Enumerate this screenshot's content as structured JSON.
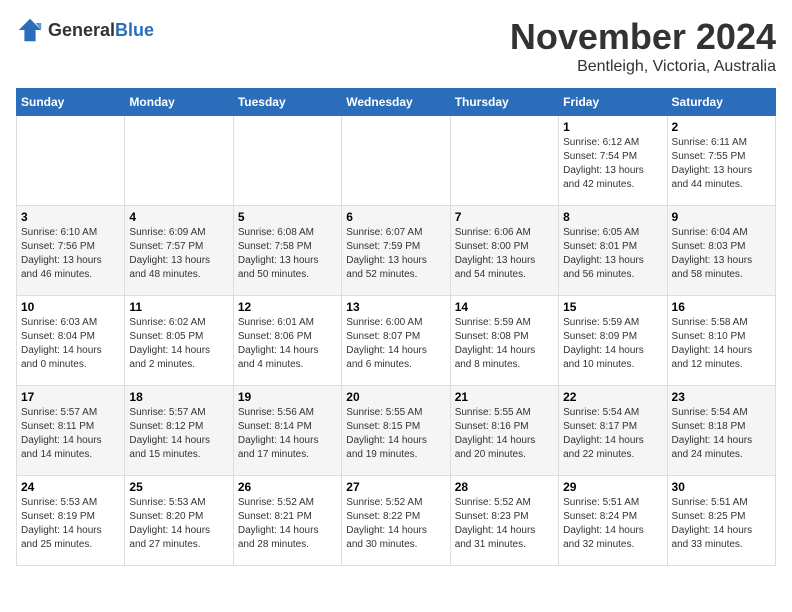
{
  "header": {
    "logo_general": "General",
    "logo_blue": "Blue",
    "month_year": "November 2024",
    "location": "Bentleigh, Victoria, Australia"
  },
  "days_of_week": [
    "Sunday",
    "Monday",
    "Tuesday",
    "Wednesday",
    "Thursday",
    "Friday",
    "Saturday"
  ],
  "weeks": [
    {
      "id": "week1",
      "days": [
        {
          "date": "",
          "info": ""
        },
        {
          "date": "",
          "info": ""
        },
        {
          "date": "",
          "info": ""
        },
        {
          "date": "",
          "info": ""
        },
        {
          "date": "",
          "info": ""
        },
        {
          "date": "1",
          "info": "Sunrise: 6:12 AM\nSunset: 7:54 PM\nDaylight: 13 hours\nand 42 minutes."
        },
        {
          "date": "2",
          "info": "Sunrise: 6:11 AM\nSunset: 7:55 PM\nDaylight: 13 hours\nand 44 minutes."
        }
      ]
    },
    {
      "id": "week2",
      "days": [
        {
          "date": "3",
          "info": "Sunrise: 6:10 AM\nSunset: 7:56 PM\nDaylight: 13 hours\nand 46 minutes."
        },
        {
          "date": "4",
          "info": "Sunrise: 6:09 AM\nSunset: 7:57 PM\nDaylight: 13 hours\nand 48 minutes."
        },
        {
          "date": "5",
          "info": "Sunrise: 6:08 AM\nSunset: 7:58 PM\nDaylight: 13 hours\nand 50 minutes."
        },
        {
          "date": "6",
          "info": "Sunrise: 6:07 AM\nSunset: 7:59 PM\nDaylight: 13 hours\nand 52 minutes."
        },
        {
          "date": "7",
          "info": "Sunrise: 6:06 AM\nSunset: 8:00 PM\nDaylight: 13 hours\nand 54 minutes."
        },
        {
          "date": "8",
          "info": "Sunrise: 6:05 AM\nSunset: 8:01 PM\nDaylight: 13 hours\nand 56 minutes."
        },
        {
          "date": "9",
          "info": "Sunrise: 6:04 AM\nSunset: 8:03 PM\nDaylight: 13 hours\nand 58 minutes."
        }
      ]
    },
    {
      "id": "week3",
      "days": [
        {
          "date": "10",
          "info": "Sunrise: 6:03 AM\nSunset: 8:04 PM\nDaylight: 14 hours\nand 0 minutes."
        },
        {
          "date": "11",
          "info": "Sunrise: 6:02 AM\nSunset: 8:05 PM\nDaylight: 14 hours\nand 2 minutes."
        },
        {
          "date": "12",
          "info": "Sunrise: 6:01 AM\nSunset: 8:06 PM\nDaylight: 14 hours\nand 4 minutes."
        },
        {
          "date": "13",
          "info": "Sunrise: 6:00 AM\nSunset: 8:07 PM\nDaylight: 14 hours\nand 6 minutes."
        },
        {
          "date": "14",
          "info": "Sunrise: 5:59 AM\nSunset: 8:08 PM\nDaylight: 14 hours\nand 8 minutes."
        },
        {
          "date": "15",
          "info": "Sunrise: 5:59 AM\nSunset: 8:09 PM\nDaylight: 14 hours\nand 10 minutes."
        },
        {
          "date": "16",
          "info": "Sunrise: 5:58 AM\nSunset: 8:10 PM\nDaylight: 14 hours\nand 12 minutes."
        }
      ]
    },
    {
      "id": "week4",
      "days": [
        {
          "date": "17",
          "info": "Sunrise: 5:57 AM\nSunset: 8:11 PM\nDaylight: 14 hours\nand 14 minutes."
        },
        {
          "date": "18",
          "info": "Sunrise: 5:57 AM\nSunset: 8:12 PM\nDaylight: 14 hours\nand 15 minutes."
        },
        {
          "date": "19",
          "info": "Sunrise: 5:56 AM\nSunset: 8:14 PM\nDaylight: 14 hours\nand 17 minutes."
        },
        {
          "date": "20",
          "info": "Sunrise: 5:55 AM\nSunset: 8:15 PM\nDaylight: 14 hours\nand 19 minutes."
        },
        {
          "date": "21",
          "info": "Sunrise: 5:55 AM\nSunset: 8:16 PM\nDaylight: 14 hours\nand 20 minutes."
        },
        {
          "date": "22",
          "info": "Sunrise: 5:54 AM\nSunset: 8:17 PM\nDaylight: 14 hours\nand 22 minutes."
        },
        {
          "date": "23",
          "info": "Sunrise: 5:54 AM\nSunset: 8:18 PM\nDaylight: 14 hours\nand 24 minutes."
        }
      ]
    },
    {
      "id": "week5",
      "days": [
        {
          "date": "24",
          "info": "Sunrise: 5:53 AM\nSunset: 8:19 PM\nDaylight: 14 hours\nand 25 minutes."
        },
        {
          "date": "25",
          "info": "Sunrise: 5:53 AM\nSunset: 8:20 PM\nDaylight: 14 hours\nand 27 minutes."
        },
        {
          "date": "26",
          "info": "Sunrise: 5:52 AM\nSunset: 8:21 PM\nDaylight: 14 hours\nand 28 minutes."
        },
        {
          "date": "27",
          "info": "Sunrise: 5:52 AM\nSunset: 8:22 PM\nDaylight: 14 hours\nand 30 minutes."
        },
        {
          "date": "28",
          "info": "Sunrise: 5:52 AM\nSunset: 8:23 PM\nDaylight: 14 hours\nand 31 minutes."
        },
        {
          "date": "29",
          "info": "Sunrise: 5:51 AM\nSunset: 8:24 PM\nDaylight: 14 hours\nand 32 minutes."
        },
        {
          "date": "30",
          "info": "Sunrise: 5:51 AM\nSunset: 8:25 PM\nDaylight: 14 hours\nand 33 minutes."
        }
      ]
    }
  ]
}
